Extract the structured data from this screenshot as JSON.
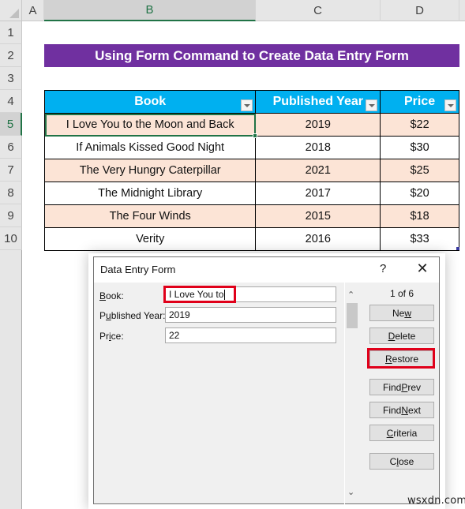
{
  "sheet": {
    "columns": [
      "A",
      "B",
      "C",
      "D"
    ],
    "active_column": "B",
    "rows": [
      "1",
      "2",
      "3",
      "4",
      "5",
      "6",
      "7",
      "8",
      "9",
      "10"
    ],
    "active_row": "5",
    "title": "Using Form Command to Create Data Entry Form",
    "table": {
      "headers": [
        "Book",
        "Published Year",
        "Price"
      ],
      "rows": [
        [
          "I Love You to the Moon and Back",
          "2019",
          "$22"
        ],
        [
          "If Animals Kissed Good Night",
          "2018",
          "$30"
        ],
        [
          "The Very Hungry Caterpillar",
          "2021",
          "$25"
        ],
        [
          "The Midnight Library",
          "2017",
          "$20"
        ],
        [
          "The Four Winds",
          "2015",
          "$18"
        ],
        [
          "Verity",
          "2016",
          "$33"
        ]
      ]
    },
    "colors": {
      "title_bg": "#7030a0",
      "header_bg": "#00b0f0",
      "band_bg": "#fce4d6",
      "selection": "#217346"
    }
  },
  "dialog": {
    "title": "Data Entry Form",
    "help_icon": "?",
    "close_icon": "✕",
    "fields": [
      {
        "label_pre": "",
        "label_ul": "B",
        "label_post": "ook:",
        "value": "I Love You to"
      },
      {
        "label_pre": "P",
        "label_ul": "u",
        "label_post": "blished Year:",
        "value": "2019"
      },
      {
        "label_pre": "Pr",
        "label_ul": "i",
        "label_post": "ce:",
        "value": "22"
      }
    ],
    "record_counter": "1 of 6",
    "buttons": [
      {
        "pre": "Ne",
        "ul": "w",
        "post": ""
      },
      {
        "pre": "",
        "ul": "D",
        "post": "elete"
      },
      {
        "pre": "",
        "ul": "R",
        "post": "estore"
      },
      {
        "pre": "Find ",
        "ul": "P",
        "post": "rev"
      },
      {
        "pre": "Find ",
        "ul": "N",
        "post": "ext"
      },
      {
        "pre": "",
        "ul": "C",
        "post": "riteria"
      },
      {
        "pre": "C",
        "ul": "l",
        "post": "ose"
      }
    ],
    "highlight_color": "#e0001a"
  },
  "watermark": "wsxdn.com"
}
